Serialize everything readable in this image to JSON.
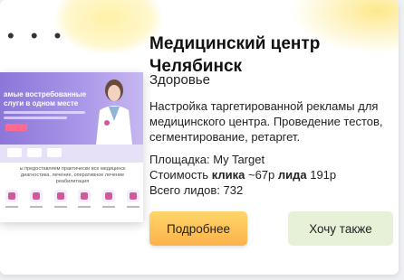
{
  "card": {
    "title_line1": "Медицинский центр",
    "title_line2": "Челябинск",
    "category": "Здоровье",
    "description": "Настройка таргетированной рекламы для медицинского центра. Проведение тестов, сегментирование, ретаргет.",
    "platform_label": "Площадка: My Target",
    "cost_prefix": "Стоимость ",
    "cost_click_label": "клика",
    "cost_click_value": " ~67р ",
    "cost_lead_label": "лида",
    "cost_lead_value": " 191р",
    "total_leads": "Всего лидов: 732",
    "more_button": "Подробнее",
    "want_button": "Хочу также",
    "dots": "• • •"
  },
  "preview": {
    "hero_text": "амые востребованные\nслуги в одном месте",
    "body_text": "ы предоставляем практически все медицинск диагностика, лечение, оперативное лечение реабилитация"
  },
  "colors": {
    "more_button_bg": "#fbb24a",
    "want_button_bg": "#e6f1d8",
    "preview_hero": "#a995e8"
  }
}
